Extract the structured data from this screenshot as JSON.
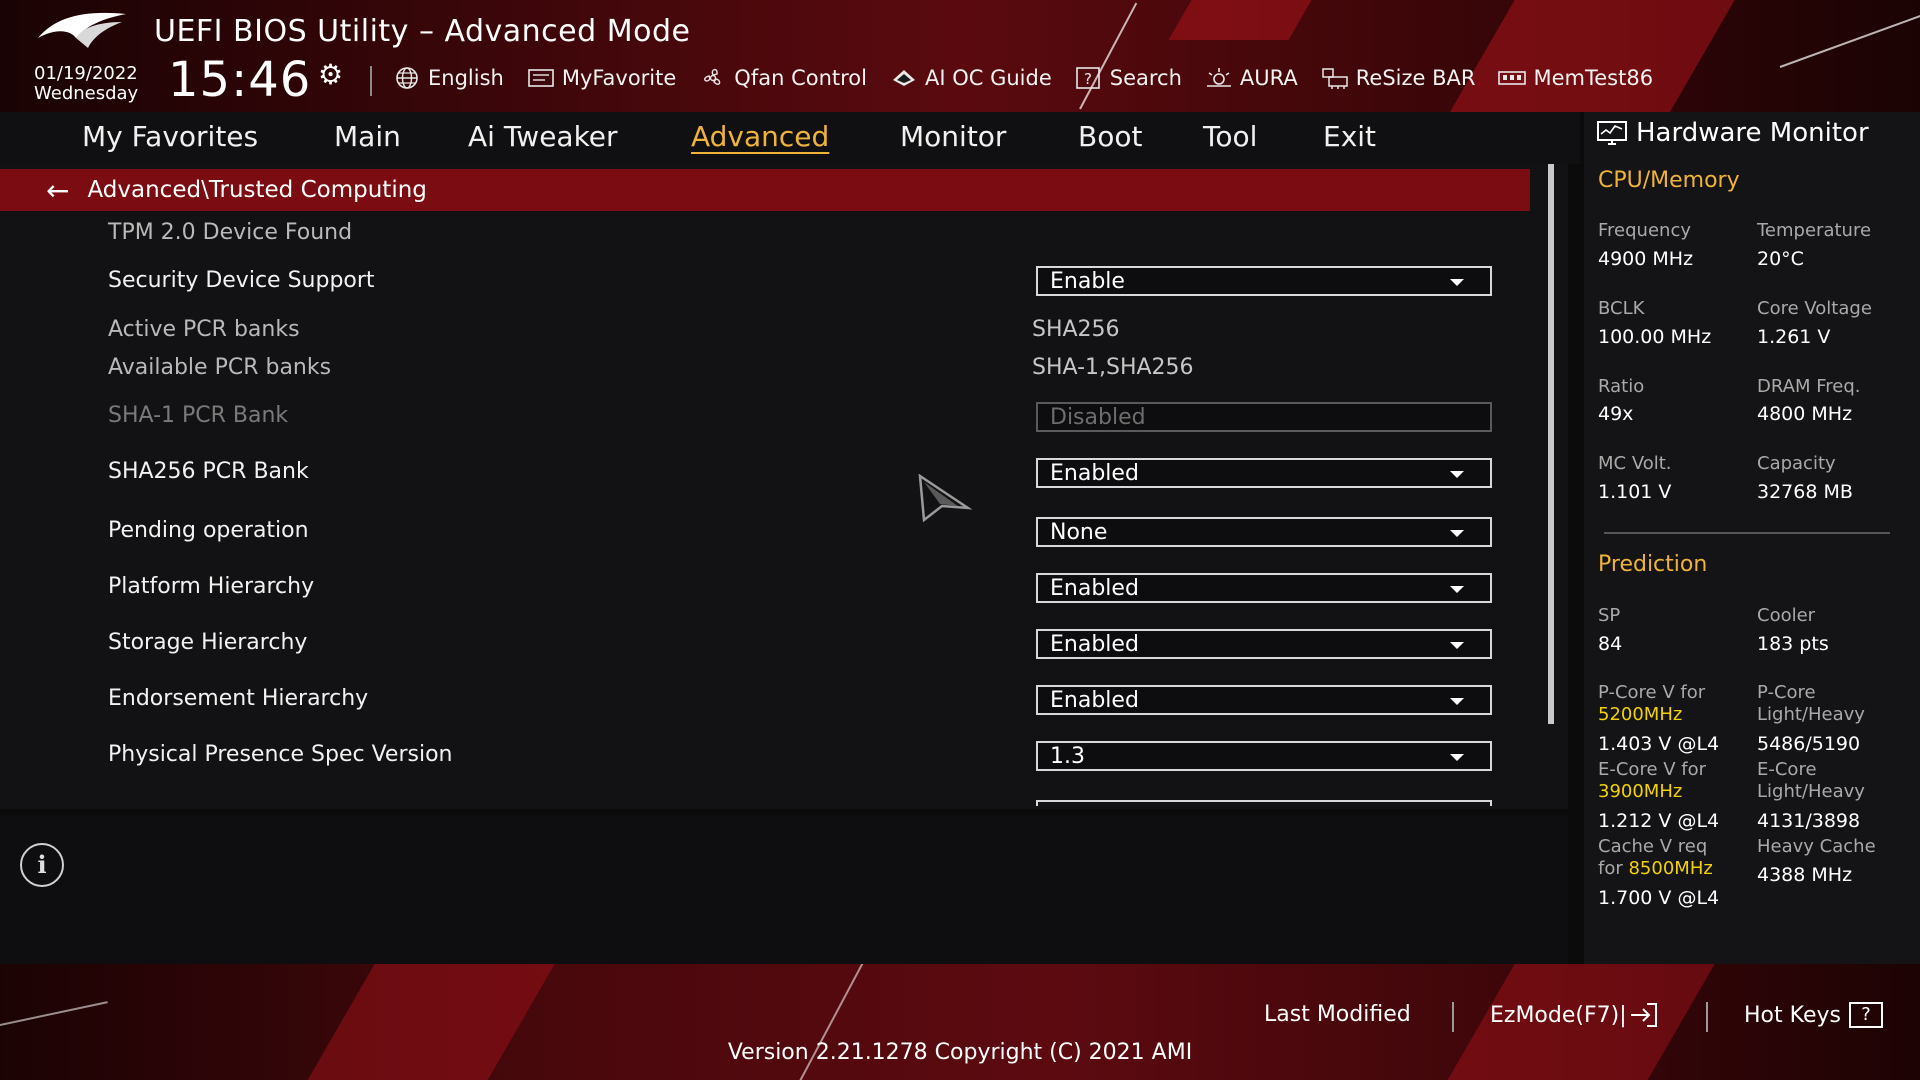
{
  "header": {
    "title": "UEFI BIOS Utility – Advanced Mode",
    "date": "01/19/2022",
    "weekday": "Wednesday",
    "time": "15:46",
    "toolbar": [
      {
        "label": "English",
        "icon": "globe-icon"
      },
      {
        "label": "MyFavorite",
        "icon": "favorite-icon"
      },
      {
        "label": "Qfan Control",
        "icon": "fan-icon"
      },
      {
        "label": "AI OC Guide",
        "icon": "ai-oc-guide-icon"
      },
      {
        "label": "Search",
        "icon": "search-icon"
      },
      {
        "label": "AURA",
        "icon": "aura-icon"
      },
      {
        "label": "ReSize BAR",
        "icon": "resize-bar-icon"
      },
      {
        "label": "MemTest86",
        "icon": "memtest-icon"
      }
    ]
  },
  "tabs": [
    {
      "label": "My Favorites"
    },
    {
      "label": "Main"
    },
    {
      "label": "Ai Tweaker"
    },
    {
      "label": "Advanced",
      "active": true
    },
    {
      "label": "Monitor"
    },
    {
      "label": "Boot"
    },
    {
      "label": "Tool"
    },
    {
      "label": "Exit"
    }
  ],
  "breadcrumb": "Advanced\\Trusted Computing",
  "settings": {
    "tpm_found": "TPM 2.0 Device Found",
    "security_device_support": {
      "label": "Security Device Support",
      "value": "Enable"
    },
    "active_pcr_banks": {
      "label": "Active PCR banks",
      "value": "SHA256"
    },
    "available_pcr_banks": {
      "label": "Available PCR banks",
      "value": "SHA-1,SHA256"
    },
    "sha1_pcr_bank": {
      "label": "SHA-1 PCR Bank",
      "value": "Disabled"
    },
    "sha256_pcr_bank": {
      "label": "SHA256 PCR Bank",
      "value": "Enabled"
    },
    "pending_operation": {
      "label": "Pending operation",
      "value": "None"
    },
    "platform_hierarchy": {
      "label": "Platform Hierarchy",
      "value": "Enabled"
    },
    "storage_hierarchy": {
      "label": "Storage Hierarchy",
      "value": "Enabled"
    },
    "endorsement_hierarchy": {
      "label": "Endorsement Hierarchy",
      "value": "Enabled"
    },
    "physical_presence_spec_version": {
      "label": "Physical Presence Spec Version",
      "value": "1.3"
    }
  },
  "hardware_monitor": {
    "title": "Hardware Monitor",
    "cpu_memory": {
      "section": "CPU/Memory",
      "frequency": {
        "label": "Frequency",
        "value": "4900 MHz"
      },
      "temperature": {
        "label": "Temperature",
        "value": "20°C"
      },
      "bclk": {
        "label": "BCLK",
        "value": "100.00 MHz"
      },
      "core_voltage": {
        "label": "Core Voltage",
        "value": "1.261 V"
      },
      "ratio": {
        "label": "Ratio",
        "value": "49x"
      },
      "dram_freq": {
        "label": "DRAM Freq.",
        "value": "4800 MHz"
      },
      "mc_volt": {
        "label": "MC Volt.",
        "value": "1.101 V"
      },
      "capacity": {
        "label": "Capacity",
        "value": "32768 MB"
      }
    },
    "prediction": {
      "section": "Prediction",
      "sp": {
        "label": "SP",
        "value": "84"
      },
      "cooler": {
        "label": "Cooler",
        "value": "183 pts"
      },
      "pcore_v_label": "P-Core V for",
      "pcore_v_freq": "5200MHz",
      "pcore_v_value": "1.403 V @L4",
      "pcore_lh_label1": "P-Core",
      "pcore_lh_label2": "Light/Heavy",
      "pcore_lh_value": "5486/5190",
      "ecore_v_label": "E-Core V for",
      "ecore_v_freq": "3900MHz",
      "ecore_v_value": "1.212 V @L4",
      "ecore_lh_label1": "E-Core",
      "ecore_lh_label2": "Light/Heavy",
      "ecore_lh_value": "4131/3898",
      "cache_v_label1": "Cache V req",
      "cache_v_label2": "for",
      "cache_v_freq": "8500MHz",
      "cache_v_value": "1.700 V @L4",
      "heavy_cache_label": "Heavy Cache",
      "heavy_cache_value": "4388 MHz"
    }
  },
  "footer": {
    "last_modified": "Last Modified",
    "ezmode": "EzMode(F7)|",
    "hot_keys": "Hot Keys",
    "hot_keys_box": "?",
    "version": "Version 2.21.1278 Copyright (C) 2021 AMI"
  },
  "colors": {
    "accent": "#f0b33a",
    "highlight_freq": "#f2d200",
    "breadcrumb_bg": "#7b0d12"
  }
}
